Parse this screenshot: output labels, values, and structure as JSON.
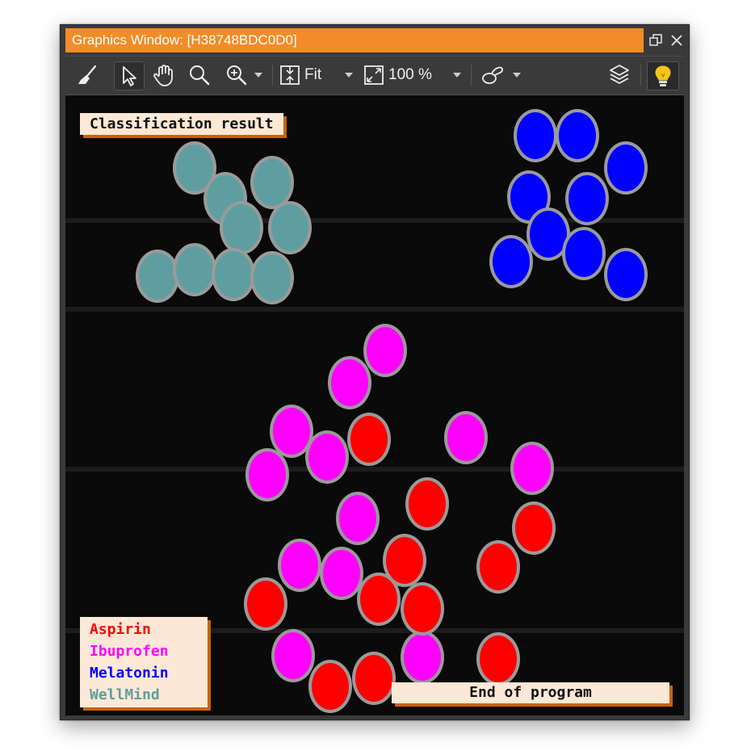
{
  "window": {
    "title": "Graphics Window: [H38748BDC0D0]"
  },
  "toolbar": {
    "fit_label": "Fit",
    "zoom_label": "100 %"
  },
  "canvas": {
    "header_label": "Classification result",
    "footer_label": "End of program",
    "legend": [
      {
        "label": "Aspirin",
        "color": "#ff0000"
      },
      {
        "label": "Ibuprofen",
        "color": "#ff00ff"
      },
      {
        "label": "Melatonin",
        "color": "#0000ff"
      },
      {
        "label": "WellMind",
        "color": "#5f9ea0"
      }
    ]
  },
  "colors": {
    "accent": "#f28c28",
    "aspirin": "#ff0000",
    "ibuprofen": "#ff00ff",
    "melatonin": "#0000ff",
    "wellmind": "#5f9ea0"
  }
}
